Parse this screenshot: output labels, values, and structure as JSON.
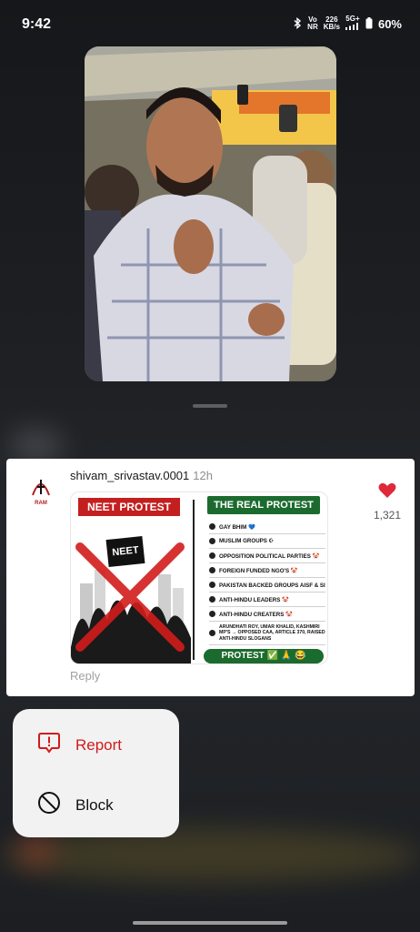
{
  "status_bar": {
    "time": "9:42",
    "network_lte": "Vo",
    "network_nr": "NR",
    "speed_value": "226",
    "speed_unit": "KB/s",
    "signal": "5G+",
    "battery": "60%"
  },
  "comment": {
    "username": "shivam_srivastav.0001",
    "timestamp": "12h",
    "like_count": "1,321",
    "reply_label": "Reply",
    "avatar_text": "RAM",
    "image": {
      "left_title": "NEET PROTEST",
      "sign_text": "NEET",
      "right_title": "THE REAL PROTEST",
      "items": [
        "GAY BHIM 💙",
        "MUSLIM GROUPS ☪",
        "OPPOSITION POLITICAL PARTIES 🤡",
        "FOREIGN FUNDED NGO'S 🤡",
        "PAKISTAN BACKED GROUPS AISF & SIF 🤡",
        "ANTI-HINDU LEADERS 🤡",
        "ANTI-HINDU CREATERS 🤡",
        "ARUNDHATI ROY, UMAR KHALID, KASHMIRI MP'S → OPPOSED CAA, ARTICLE 370, RAISED ANTI-HINDU SLOGANS"
      ],
      "banner": "PROTEST ✅ 🙏 😂"
    }
  },
  "menu": {
    "report_label": "Report",
    "block_label": "Block"
  },
  "colors": {
    "like": "#e0283c",
    "report": "#d11b1b",
    "neet_red": "#c41f1f",
    "real_green": "#1c6b2e"
  }
}
